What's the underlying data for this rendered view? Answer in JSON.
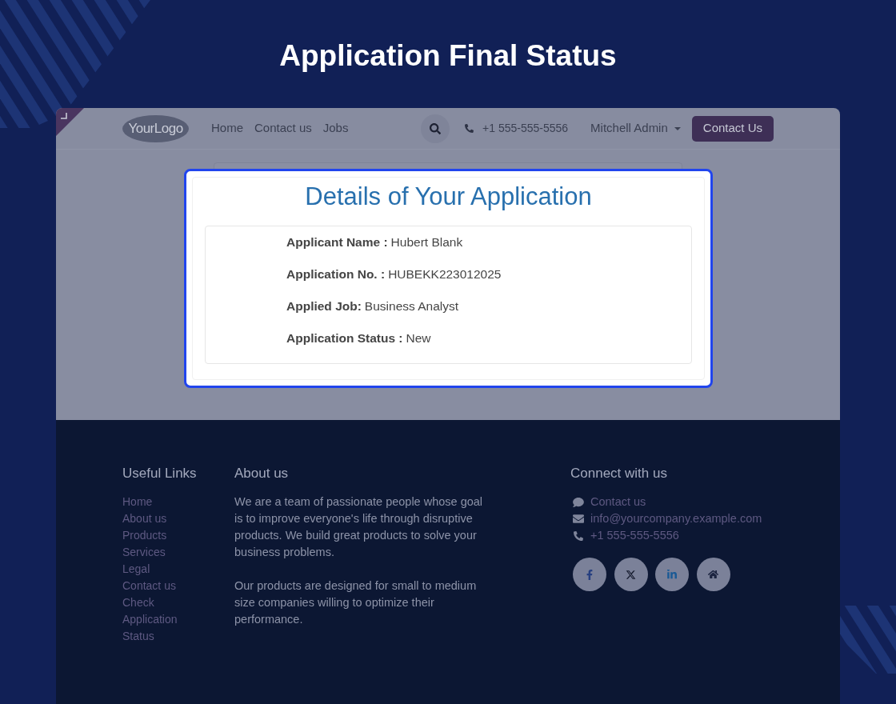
{
  "title": "Application Final Status",
  "header": {
    "logo": "**Your**Logo",
    "nav": [
      "Home",
      "Contact us",
      "Jobs"
    ],
    "phone": "+1 555-555-5556",
    "user": "Mitchell Admin",
    "cta": "Contact Us"
  },
  "details_card": {
    "title": "Details of Your Application",
    "fields": [
      {
        "label": "Applicant Name :",
        "value": "Hubert Blank"
      },
      {
        "label": "Application No. :",
        "value": "HUBEKK223012025"
      },
      {
        "label": "Applied Job:",
        "value": "Business Analyst"
      },
      {
        "label": "Application Status :",
        "value": "New"
      }
    ]
  },
  "footer": {
    "useful_links": {
      "heading": "Useful Links",
      "links": [
        "Home",
        "About us",
        "Products",
        "Services",
        "Legal",
        "Contact us",
        "Check Application Status"
      ]
    },
    "about": {
      "heading": "About us",
      "paragraphs": [
        "We are a team of passionate people whose goal is to improve everyone's life through disruptive products. We build great products to solve your business problems.",
        "Our products are designed for small to medium size companies willing to optimize their performance."
      ]
    },
    "connect": {
      "heading": "Connect with us",
      "items": [
        {
          "kind": "chat",
          "text": "Contact us"
        },
        {
          "kind": "email",
          "text": "info@yourcompany.example.com"
        },
        {
          "kind": "phone",
          "text": "+1 555-555-5556"
        }
      ],
      "social": [
        {
          "kind": "facebook"
        },
        {
          "kind": "x"
        },
        {
          "kind": "linkedin"
        },
        {
          "kind": "home"
        }
      ]
    }
  }
}
